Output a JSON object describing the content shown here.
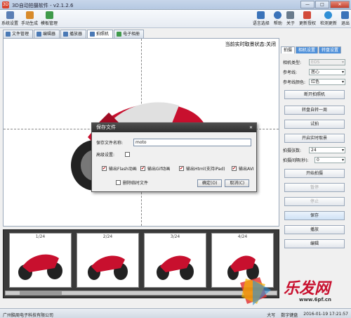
{
  "app": {
    "title": "3D自动拍摄软件 - v2.1.2.6"
  },
  "window_buttons": {
    "minimize": "—",
    "maximize": "□",
    "close": "✕"
  },
  "toolbar_left": [
    {
      "label": "系统设置",
      "icon": "gear-icon",
      "color": "#5b7fb5"
    },
    {
      "label": "手动生成",
      "icon": "hand-icon",
      "color": "#d88a2a"
    },
    {
      "label": "模板管理",
      "icon": "template-icon",
      "color": "#3f9a4a"
    }
  ],
  "toolbar_right": [
    {
      "label": "语言选择",
      "icon": "language-icon",
      "color": "#3b73b9"
    },
    {
      "label": "帮助",
      "icon": "help-icon",
      "color": "#3b73b9"
    },
    {
      "label": "关于",
      "icon": "about-icon",
      "color": "#6a7b8c"
    },
    {
      "label": "更新授权",
      "icon": "license-icon",
      "color": "#d24a3a"
    },
    {
      "label": "检测更新",
      "icon": "update-icon",
      "color": "#2f8fd6"
    },
    {
      "label": "退出",
      "icon": "exit-icon",
      "color": "#3b73b9"
    }
  ],
  "tabs": [
    {
      "label": "文件管理"
    },
    {
      "label": "编辑器"
    },
    {
      "label": "播放器"
    },
    {
      "label": "拍照机"
    },
    {
      "label": "电子相册"
    }
  ],
  "preview": {
    "status": "当前实时取景状态:关闭"
  },
  "dialog": {
    "title": "保存文件",
    "filename_label": "保存文件名称:",
    "filename_value": "moto",
    "advanced_label": "高级设置:",
    "options": [
      "输出Flash动画",
      "输出Gif动画",
      "输出Html(支持iPad)",
      "输出AVI"
    ],
    "delete_temp": "删除临时文件",
    "ok": "确定(O)",
    "cancel": "取消(C)",
    "close": "✕"
  },
  "thumbnails": [
    "1/24",
    "2/24",
    "3/24",
    "4/24"
  ],
  "right_tabs": [
    "拍摄",
    "相机设置",
    "转盘设置"
  ],
  "right_fields": {
    "camera_type_label": "相机类型:",
    "camera_type_value": "EOS",
    "guide_label": "参考线:",
    "guide_value": "居心",
    "guide_color_label": "参考线颜色:",
    "guide_color_value": "红色",
    "shots_label": "拍摄张数:",
    "shots_value": "24",
    "interval_label": "拍摄间隔(秒):",
    "interval_value": "0"
  },
  "right_buttons": {
    "open_camera": "断开拍照机",
    "rotate": "转盘自转一周",
    "test": "试拍",
    "live_view": "开启实时取景",
    "start": "开始拍摄",
    "pause": "暂停",
    "stop": "停止",
    "save": "保存",
    "play": "播放",
    "edit": "编辑"
  },
  "statusbar": {
    "company": "广州脑周电子科技有限公司",
    "caps": "大写",
    "num": "数字键盘",
    "datetime": "2016-01-19 17:21:57"
  },
  "watermark": {
    "text": "乐发网",
    "url": "www.6pf.cn"
  },
  "colors": {
    "accent": "#4d8fd9",
    "bike_red": "#c8102e"
  }
}
